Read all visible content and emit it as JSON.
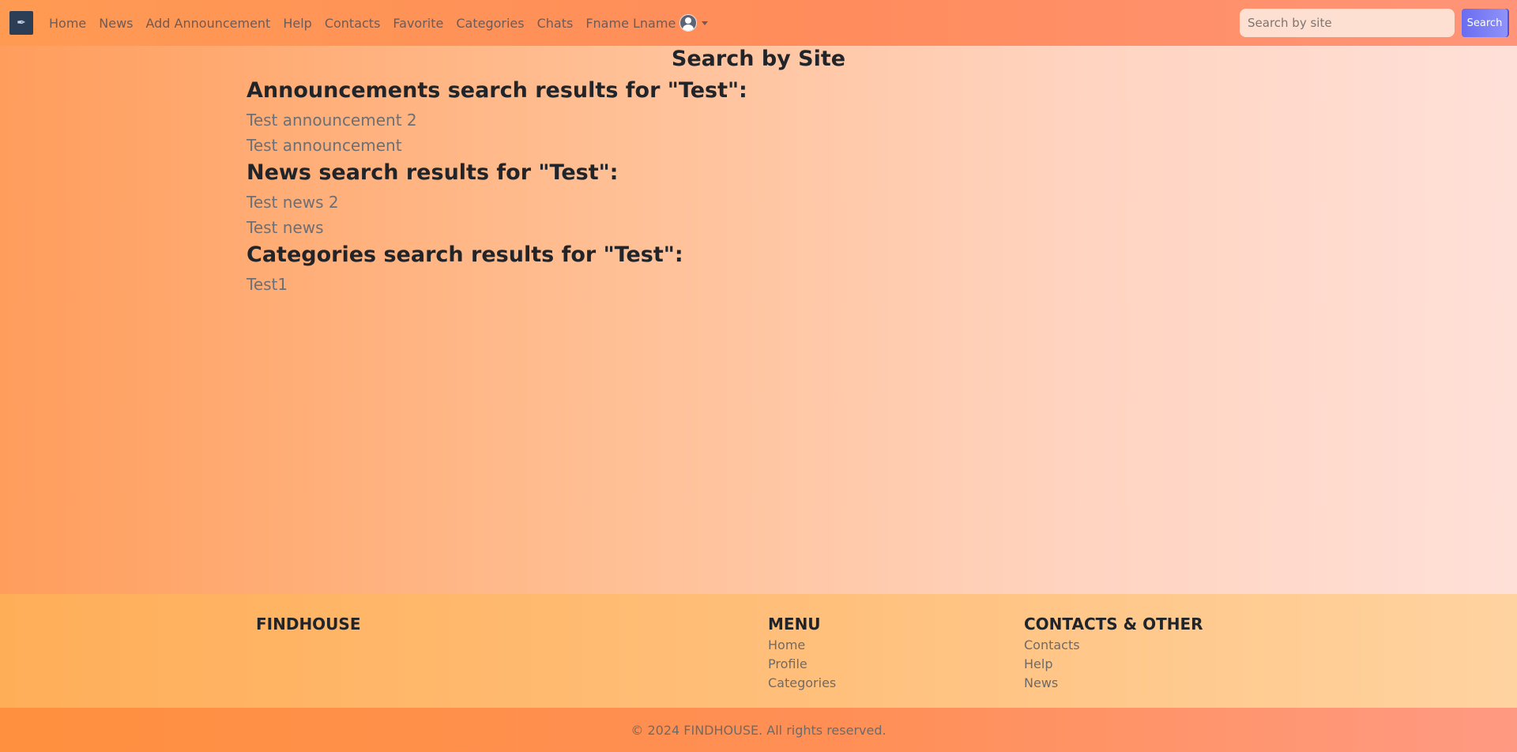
{
  "navbar": {
    "brand_icon": "feather-logo-icon",
    "links": [
      "Home",
      "News",
      "Add Announcement",
      "Help",
      "Contacts",
      "Favorite",
      "Categories",
      "Chats"
    ],
    "user_name": "Fname Lname",
    "search_placeholder": "Search by site",
    "search_button": "Search"
  },
  "main": {
    "title": "Search by Site",
    "sections": [
      {
        "title": "Announcements search results for \"Test\":",
        "items": [
          "Test announcement 2",
          "Test announcement"
        ]
      },
      {
        "title": "News search results for \"Test\":",
        "items": [
          "Test news 2",
          "Test news"
        ]
      },
      {
        "title": "Categories search results for \"Test\":",
        "items": [
          "Test1"
        ]
      }
    ]
  },
  "footer": {
    "brand": "FINDHOUSE",
    "menu_heading": "MENU",
    "menu_links": [
      "Home",
      "Profile",
      "Categories"
    ],
    "contacts_heading": "CONTACTS & OTHER",
    "contacts_links": [
      "Contacts",
      "Help",
      "News"
    ],
    "copyright": "© 2024 FINDHOUSE. All rights reserved."
  },
  "colors": {
    "navbar": "#ff8c5c",
    "search_button": "#6a6cf0",
    "link": "#6c6f73"
  }
}
